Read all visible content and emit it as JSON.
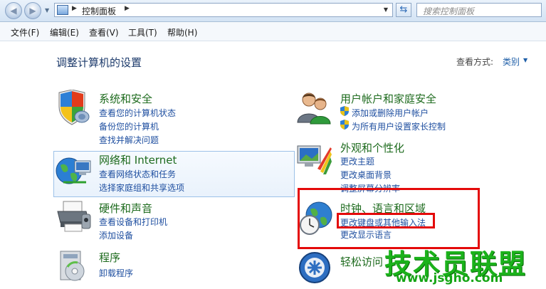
{
  "address_bar": {
    "breadcrumb": "控制面板",
    "search_placeholder": "搜索控制面板"
  },
  "menu": {
    "items": [
      "文件(F)",
      "编辑(E)",
      "查看(V)",
      "工具(T)",
      "帮助(H)"
    ]
  },
  "content": {
    "title": "调整计算机的设置",
    "view_by_label": "查看方式:",
    "view_by_value": "类别"
  },
  "categories": {
    "system_security": {
      "title": "系统和安全",
      "links": [
        "查看您的计算机状态",
        "备份您的计算机",
        "查找并解决问题"
      ]
    },
    "network": {
      "title": "网络和 Internet",
      "links": [
        "查看网络状态和任务",
        "选择家庭组和共享选项"
      ]
    },
    "hardware": {
      "title": "硬件和声音",
      "links": [
        "查看设备和打印机",
        "添加设备"
      ]
    },
    "programs": {
      "title": "程序",
      "links": [
        "卸载程序"
      ]
    },
    "user_accounts": {
      "title": "用户帐户和家庭安全",
      "links": [
        "添加或删除用户帐户",
        "为所有用户设置家长控制"
      ]
    },
    "appearance": {
      "title": "外观和个性化",
      "links": [
        "更改主题",
        "更改桌面背景",
        "调整屏幕分辨率"
      ]
    },
    "clock_region": {
      "title": "时钟、语言和区域",
      "links": [
        "更改键盘或其他输入法",
        "更改显示语言"
      ]
    },
    "ease_of_access": {
      "title": "轻松访问"
    }
  },
  "watermark": {
    "name": "技术员联盟",
    "url": "www.jsgho.com"
  },
  "colors": {
    "accent_red": "#e40a0a",
    "link_blue": "#1f4fa0",
    "category_green": "#1e6b1e"
  }
}
